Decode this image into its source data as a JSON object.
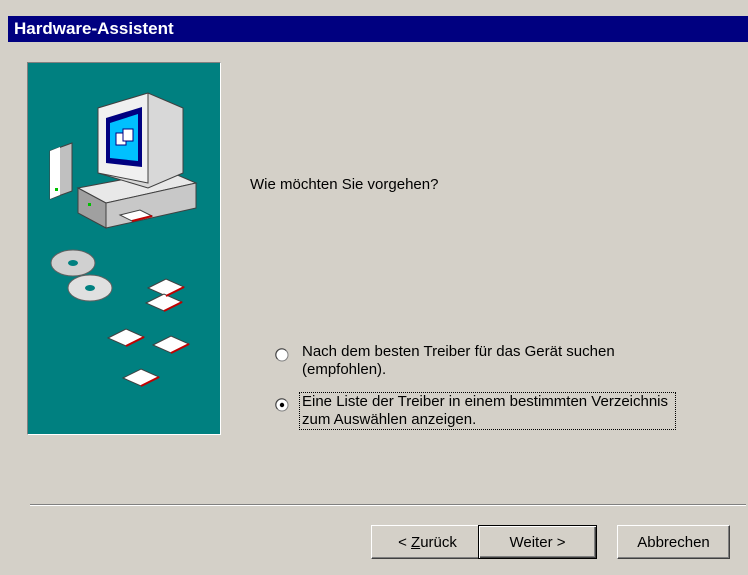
{
  "window": {
    "title": "Hardware-Assistent"
  },
  "main": {
    "question": "Wie möchten Sie vorgehen?",
    "options": [
      {
        "label": "Nach dem besten Treiber für das Gerät suchen (empfohlen).",
        "selected": false
      },
      {
        "label": "Eine Liste der Treiber in einem bestimmten Verzeichnis zum Auswählen anzeigen.",
        "selected": true
      }
    ]
  },
  "buttons": {
    "back_prefix": "< ",
    "back_accel": "Z",
    "back_rest": "urück",
    "next": "Weiter >",
    "cancel": "Abbrechen"
  },
  "colors": {
    "titlebar": "#000080",
    "illustration_bg": "#008080",
    "face": "#d4d0c8"
  },
  "icons": {
    "illustration": "computer-with-cds-and-floppies"
  }
}
